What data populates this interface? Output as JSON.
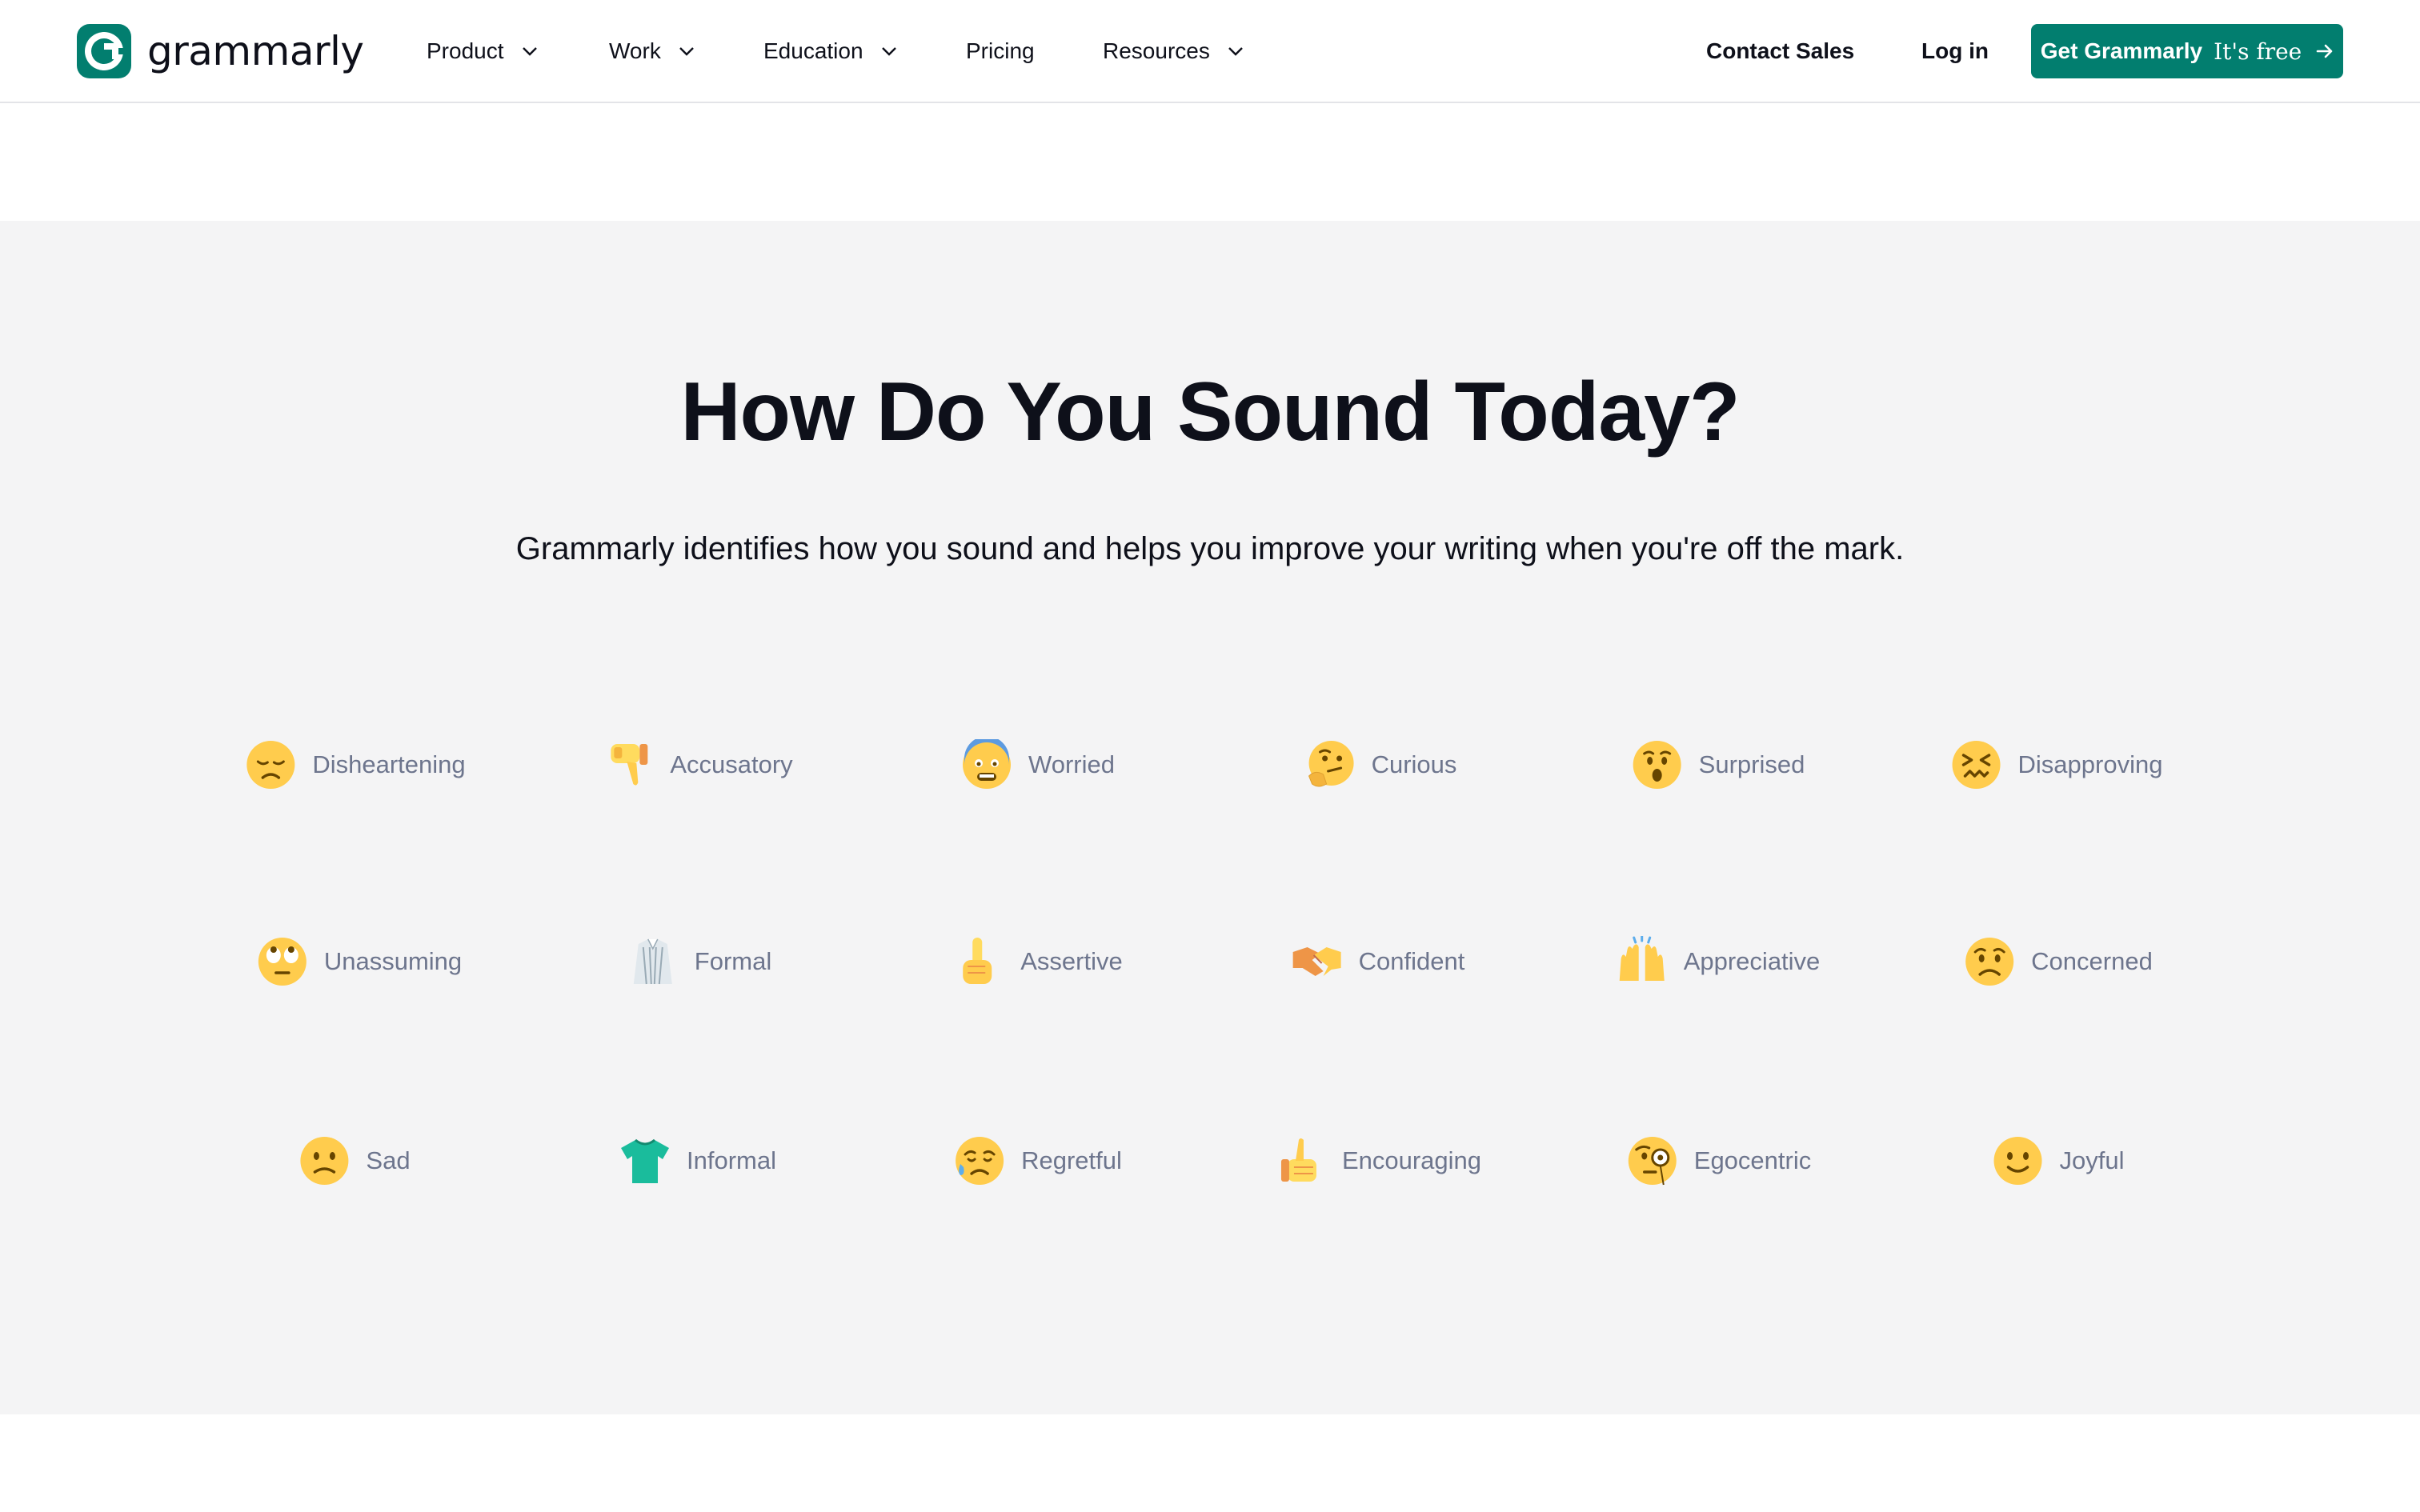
{
  "header": {
    "logo_text": "grammarly",
    "nav": [
      {
        "label": "Product",
        "has_dropdown": true
      },
      {
        "label": "Work",
        "has_dropdown": true
      },
      {
        "label": "Education",
        "has_dropdown": true
      },
      {
        "label": "Pricing",
        "has_dropdown": false
      },
      {
        "label": "Resources",
        "has_dropdown": true
      }
    ],
    "contact_sales": "Contact Sales",
    "log_in": "Log in",
    "cta_main": "Get Grammarly",
    "cta_sub": "It's free"
  },
  "tones_section": {
    "title": "How Do You Sound Today?",
    "subtitle": "Grammarly identifies how you sound and helps you improve your writing when you're off the mark.",
    "tones": [
      {
        "label": "Disheartening",
        "icon": "disappointed-face-icon"
      },
      {
        "label": "Accusatory",
        "icon": "thumbs-down-icon"
      },
      {
        "label": "Worried",
        "icon": "anxious-face-icon"
      },
      {
        "label": "Curious",
        "icon": "thinking-face-icon"
      },
      {
        "label": "Surprised",
        "icon": "hushed-face-icon"
      },
      {
        "label": "Disapproving",
        "icon": "confounded-face-icon"
      },
      {
        "label": "Unassuming",
        "icon": "rolling-eyes-face-icon"
      },
      {
        "label": "Formal",
        "icon": "dress-shirt-icon"
      },
      {
        "label": "Assertive",
        "icon": "index-pointing-up-icon"
      },
      {
        "label": "Confident",
        "icon": "handshake-icon"
      },
      {
        "label": "Appreciative",
        "icon": "raising-hands-icon"
      },
      {
        "label": "Concerned",
        "icon": "worried-face-icon"
      },
      {
        "label": "Sad",
        "icon": "slightly-frowning-face-icon"
      },
      {
        "label": "Informal",
        "icon": "t-shirt-icon"
      },
      {
        "label": "Regretful",
        "icon": "sad-but-relieved-face-icon"
      },
      {
        "label": "Encouraging",
        "icon": "thumbs-up-icon"
      },
      {
        "label": "Egocentric",
        "icon": "face-with-monocle-icon"
      },
      {
        "label": "Joyful",
        "icon": "slightly-smiling-face-icon"
      }
    ]
  },
  "colors": {
    "brand_green": "#027e6f",
    "section_background": "#f4f4f5",
    "tone_label": "#6d758d",
    "text_dark": "#0e101a",
    "emoji_yellow": "#ffcc4d"
  }
}
